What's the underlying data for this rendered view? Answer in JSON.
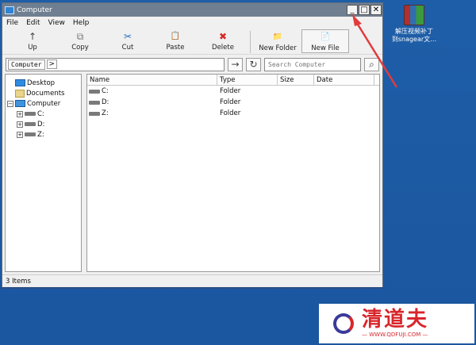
{
  "window": {
    "title": "Computer",
    "controls": {
      "minimize": "_",
      "maximize": "□",
      "close": "✕"
    }
  },
  "menu": [
    "File",
    "Edit",
    "View",
    "Help"
  ],
  "toolbar": {
    "up": {
      "label": "Up",
      "icon": "↑"
    },
    "copy": {
      "label": "Copy",
      "icon": "⧉"
    },
    "cut": {
      "label": "Cut",
      "icon": "✂"
    },
    "paste": {
      "label": "Paste",
      "icon": "📋"
    },
    "delete": {
      "label": "Delete",
      "icon": "✖"
    },
    "new_folder": {
      "label": "New Folder",
      "icon": "📁"
    },
    "new_file": {
      "label": "New File",
      "icon": "📄"
    }
  },
  "address": {
    "crumb": "Computer",
    "crumb_arrow": ">",
    "go_icon": "→",
    "refresh_icon": "↻",
    "search_placeholder": "Search Computer",
    "search_icon": "⌕"
  },
  "tree": [
    {
      "label": "Desktop",
      "icon": "desktop-icon"
    },
    {
      "label": "Documents",
      "icon": "documents-icon"
    },
    {
      "label": "Computer",
      "icon": "computer-icon",
      "expanded": "−"
    },
    {
      "label": "C:",
      "icon": "drive-icon",
      "expanded": "+"
    },
    {
      "label": "D:",
      "icon": "drive-icon",
      "expanded": "+"
    },
    {
      "label": "Z:",
      "icon": "drive-icon",
      "expanded": "+"
    }
  ],
  "list": {
    "columns": [
      "Name",
      "Type",
      "Size",
      "Date"
    ],
    "rows": [
      {
        "name": "C:",
        "type": "Folder"
      },
      {
        "name": "D:",
        "type": "Folder"
      },
      {
        "name": "Z:",
        "type": "Folder"
      }
    ]
  },
  "status": "3 Items",
  "desktop_icon": {
    "label_line1": "解压视频补丁",
    "label_line2": "到snagear文…"
  },
  "watermark": {
    "brand": "清道夫",
    "url": "— WWW.QDFUJI.COM —"
  },
  "colors": {
    "desktop": "#1f5ba3",
    "titlebar": "#6f7f91",
    "arrow": "#e23b3b"
  }
}
